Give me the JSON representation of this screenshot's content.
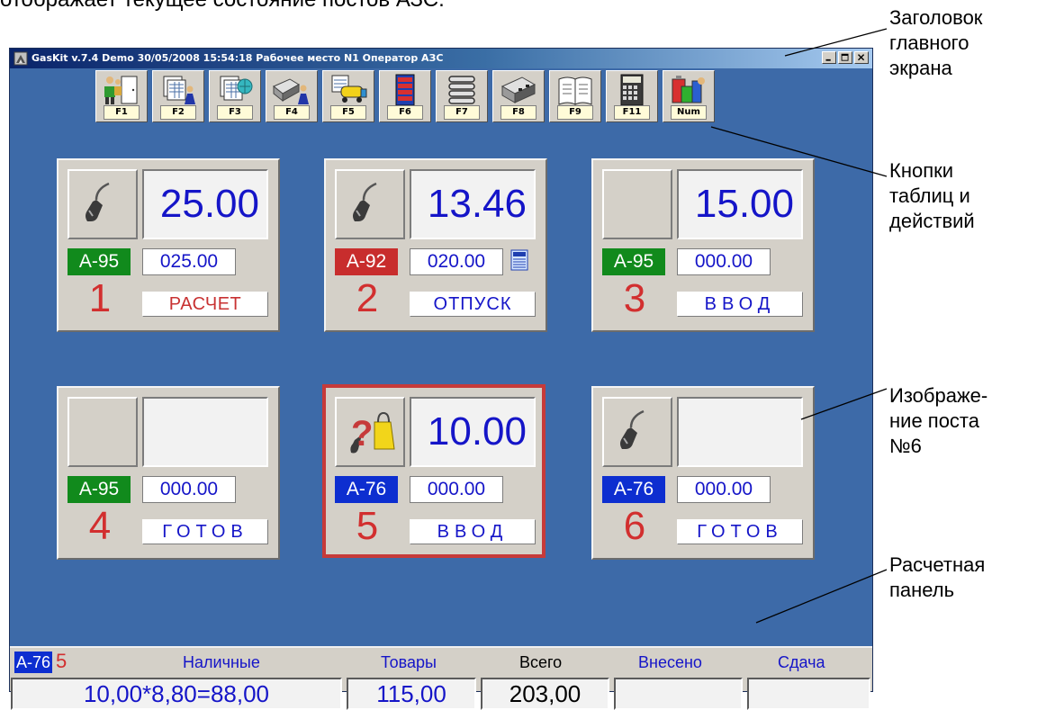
{
  "intro_text": "отображает текущее состояние постов АЗС.",
  "window": {
    "title": "GasKit v.7.4 Demo  30/05/2008 15:54:18  Рабочее место N1  Оператор АЗС"
  },
  "toolbar": [
    {
      "key": "F1",
      "icon": "operator-door-icon"
    },
    {
      "key": "F2",
      "icon": "tables-user-icon"
    },
    {
      "key": "F3",
      "icon": "tables-globe-icon"
    },
    {
      "key": "F4",
      "icon": "dispenser-user-icon"
    },
    {
      "key": "F5",
      "icon": "tank-truck-icon"
    },
    {
      "key": "F6",
      "icon": "counters-icon"
    },
    {
      "key": "F7",
      "icon": "list-icon"
    },
    {
      "key": "F8",
      "icon": "dispenser-icon"
    },
    {
      "key": "F9",
      "icon": "book-icon"
    },
    {
      "key": "F11",
      "icon": "calculator-icon"
    },
    {
      "key": "Num",
      "icon": "goods-icon"
    }
  ],
  "posts": [
    {
      "number": "1",
      "amount": "25.00",
      "fuel": "А-95",
      "fuel_color": "#118a1c",
      "volume": "025.00",
      "state": "РАСЧЕТ",
      "nozzle": true
    },
    {
      "number": "2",
      "amount": "13.46",
      "fuel": "А-92",
      "fuel_color": "#c82d2d",
      "volume": "020.00",
      "state": "ОТПУСК",
      "nozzle": true,
      "terminal": true
    },
    {
      "number": "3",
      "amount": "15.00",
      "fuel": "А-95",
      "fuel_color": "#118a1c",
      "volume": "000.00",
      "state": "ВВОД",
      "nozzle": false
    },
    {
      "number": "4",
      "amount": "",
      "fuel": "А-95",
      "fuel_color": "#118a1c",
      "volume": "000.00",
      "state": "ГОТОВ",
      "nozzle": false
    },
    {
      "number": "5",
      "amount": "10.00",
      "fuel": "А-76",
      "fuel_color": "#0d2ed0",
      "volume": "000.00",
      "state": "ВВОД",
      "nozzle": true,
      "question": true,
      "active": true
    },
    {
      "number": "6",
      "amount": "",
      "fuel": "А-76",
      "fuel_color": "#0d2ed0",
      "volume": "000.00",
      "state": "ГОТОВ",
      "nozzle": true
    }
  ],
  "panel": {
    "fuel": "А-76",
    "post_number": "5",
    "labels": {
      "cash": "Наличные",
      "goods": "Товары",
      "total": "Всего",
      "paid": "Внесено",
      "change": "Сдача"
    },
    "values": {
      "cash": "10,00*8,80=88,00",
      "goods": "115,00",
      "total": "203,00",
      "paid": "",
      "change": ""
    }
  },
  "annotations": {
    "title": "Заголовок главного экрана",
    "buttons": "Кнопки таблиц и действий",
    "post6": "Изображе-ние поста №6",
    "panel": "Расчетная панель"
  },
  "colors": {
    "background": "#3d6aa8",
    "panel": "#d4d0c8",
    "digits": "#1515c8",
    "post_number": "#d22f2f"
  }
}
